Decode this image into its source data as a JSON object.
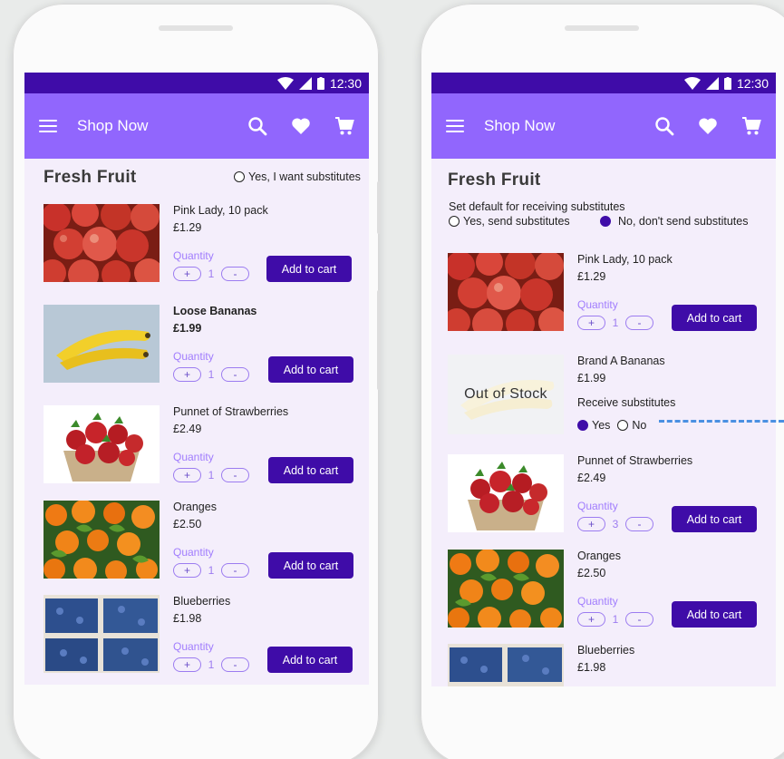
{
  "status": {
    "time": "12:30"
  },
  "app": {
    "title": "Shop Now"
  },
  "icons": {
    "menu": "menu-icon",
    "search": "search-icon",
    "favorite": "heart-icon",
    "cart": "cart-icon"
  },
  "colors": {
    "status_bar": "#3f0ca8",
    "app_bar": "#9166fd",
    "button": "#3f0ca8",
    "screen_bg": "#f4eefb",
    "connector": "#4a90e2"
  },
  "left": {
    "section_title": "Fresh Fruit",
    "substitutes_option": "Yes, I want substitutes",
    "products": [
      {
        "name": "Pink Lady, 10 pack",
        "price": "£1.29",
        "qty_label": "Quantity",
        "qty": "1",
        "add_label": "Add to cart",
        "image": "apples"
      },
      {
        "name": "Loose Bananas",
        "price": "£1.99",
        "qty_label": "Quantity",
        "qty": "1",
        "add_label": "Add to cart",
        "image": "bananas"
      },
      {
        "name": "Punnet of Strawberries",
        "price": "£2.49",
        "qty_label": "Quantity",
        "qty": "1",
        "add_label": "Add to cart",
        "image": "strawberries"
      },
      {
        "name": "Oranges",
        "price": "£2.50",
        "qty_label": "Quantity",
        "qty": "1",
        "add_label": "Add to cart",
        "image": "oranges"
      },
      {
        "name": "Blueberries",
        "price": "£1.98",
        "qty_label": "Quantity",
        "qty": "1",
        "add_label": "Add to cart",
        "image": "blueberries"
      }
    ]
  },
  "right": {
    "section_title": "Fresh Fruit",
    "default_sub_label": "Set default for receiving substitutes",
    "default_yes": "Yes, send substitutes",
    "default_no": "No, don't send substitutes",
    "products": [
      {
        "name": "Pink Lady, 10 pack",
        "price": "£1.29",
        "qty_label": "Quantity",
        "qty": "1",
        "add_label": "Add to cart",
        "image": "apples"
      },
      {
        "name": "Brand A Bananas",
        "price": "£1.99",
        "out_of_stock": "Out of  Stock",
        "receive_label": "Receive substitutes",
        "yes": "Yes",
        "no": "No",
        "image": "bananas"
      },
      {
        "name": "Punnet of Strawberries",
        "price": "£2.49",
        "qty_label": "Quantity",
        "qty": "3",
        "add_label": "Add to cart",
        "image": "strawberries"
      },
      {
        "name": "Oranges",
        "price": "£2.50",
        "qty_label": "Quantity",
        "qty": "1",
        "add_label": "Add to cart",
        "image": "oranges"
      },
      {
        "name": "Blueberries",
        "price": "£1.98",
        "image": "blueberries"
      }
    ]
  },
  "qty_controls": {
    "plus": "+",
    "minus": "-"
  }
}
